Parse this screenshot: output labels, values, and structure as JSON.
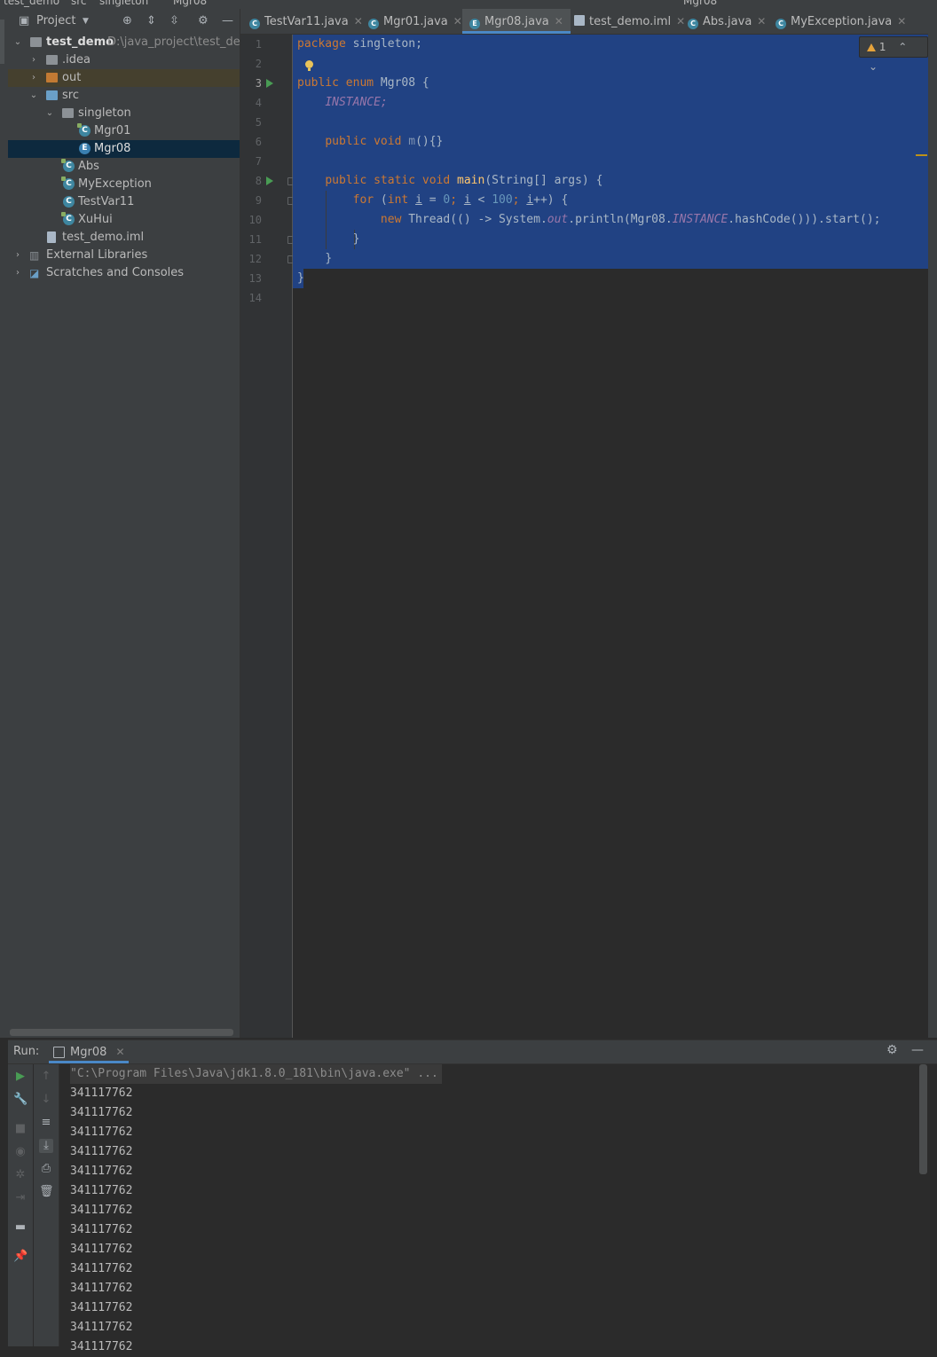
{
  "breadcrumb": {
    "project": "test_demo",
    "src": "src",
    "package": "singleton",
    "file": "Mgr08",
    "run_config": "Mgr08"
  },
  "project_panel": {
    "title": "Project",
    "tree": [
      {
        "label": "test_demo",
        "path": "D:\\java_project\\test_demo"
      },
      {
        "label": ".idea"
      },
      {
        "label": "out"
      },
      {
        "label": "src"
      },
      {
        "label": "singleton"
      },
      {
        "label": "Mgr01"
      },
      {
        "label": "Mgr08"
      },
      {
        "label": "Abs"
      },
      {
        "label": "MyException"
      },
      {
        "label": "TestVar11"
      },
      {
        "label": "XuHui"
      },
      {
        "label": "test_demo.iml"
      },
      {
        "label": "External Libraries"
      },
      {
        "label": "Scratches and Consoles"
      }
    ]
  },
  "editor_tabs": [
    {
      "label": "TestVar11.java"
    },
    {
      "label": "Mgr01.java"
    },
    {
      "label": "Mgr08.java",
      "active": true
    },
    {
      "label": "test_demo.iml"
    },
    {
      "label": "Abs.java"
    },
    {
      "label": "MyException.java"
    }
  ],
  "editor": {
    "line_numbers": [
      "1",
      "2",
      "3",
      "4",
      "5",
      "6",
      "7",
      "8",
      "9",
      "10",
      "11",
      "12",
      "13",
      "14"
    ],
    "warning_count": "1",
    "code": {
      "l1_kw": "package",
      "l1_rest": " singleton;",
      "l3_kw": "public enum",
      "l3_rest": " Mgr08 {",
      "l4": "INSTANCE;",
      "l6_kw": "public void",
      "l6_fn": "m",
      "l6_rest": "(){}",
      "l8_kw": "public static void",
      "l8_fn": "main",
      "l8_rest": "(String[] args) {",
      "l9_for": "for",
      "l9_p1": " (",
      "l9_int": "int",
      "l9_i1": "i",
      "l9_eq": " = ",
      "l9_zero": "0",
      "l9_semi1": "; ",
      "l9_i2": "i",
      "l9_lt": " < ",
      "l9_hundred": "100",
      "l9_semi2": "; ",
      "l9_i3": "i",
      "l9_end": "++) {",
      "l10_new": "new",
      "l10_a": " Thread(() -> System.",
      "l10_out": "out",
      "l10_b": ".println(Mgr08.",
      "l10_inst": "INSTANCE",
      "l10_c": ".hashCode())).start();",
      "l11": "}",
      "l12": "}",
      "l13": "}"
    }
  },
  "run_panel": {
    "label": "Run:",
    "tab": "Mgr08",
    "command": "\"C:\\Program Files\\Java\\jdk1.8.0_181\\bin\\java.exe\" ...",
    "output": [
      "341117762",
      "341117762",
      "341117762",
      "341117762",
      "341117762",
      "341117762",
      "341117762",
      "341117762",
      "341117762",
      "341117762",
      "341117762",
      "341117762",
      "341117762",
      "341117762"
    ]
  },
  "colors": {
    "selection": "#214283",
    "keyword": "#cc7832",
    "field": "#9876aa",
    "method": "#ffc66d",
    "number": "#6897bb",
    "accent": "#4a88c7"
  }
}
